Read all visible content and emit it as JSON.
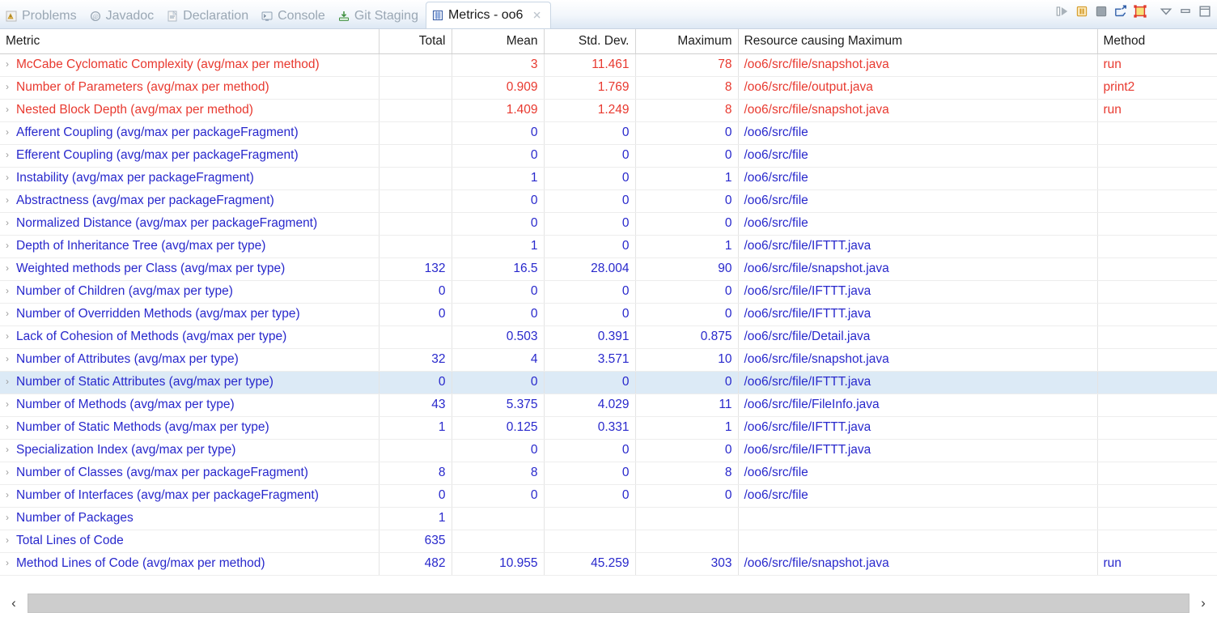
{
  "tabs": [
    {
      "label": "Problems",
      "icon": "problems-icon",
      "active": false
    },
    {
      "label": "Javadoc",
      "icon": "javadoc-icon",
      "active": false
    },
    {
      "label": "Declaration",
      "icon": "declaration-icon",
      "active": false
    },
    {
      "label": "Console",
      "icon": "console-icon",
      "active": false
    },
    {
      "label": "Git Staging",
      "icon": "git-staging-icon",
      "active": false
    },
    {
      "label": "Metrics - oo6",
      "icon": "metrics-icon",
      "active": true
    }
  ],
  "toolbar": {
    "buttons": [
      {
        "name": "run-metrics-icon",
        "title": "Run"
      },
      {
        "name": "pause-metrics-icon",
        "title": "Pause"
      },
      {
        "name": "stop-metrics-icon",
        "title": "Stop"
      },
      {
        "name": "export-metrics-icon",
        "title": "Export"
      },
      {
        "name": "dependency-graph-icon",
        "title": "Dependency Graph"
      },
      {
        "name": "view-menu-icon",
        "title": "View Menu"
      },
      {
        "name": "minimize-view-icon",
        "title": "Minimize"
      },
      {
        "name": "maximize-view-icon",
        "title": "Maximize"
      }
    ]
  },
  "table": {
    "columns": [
      {
        "label": "Metric",
        "align": "left"
      },
      {
        "label": "Total",
        "align": "right"
      },
      {
        "label": "Mean",
        "align": "right"
      },
      {
        "label": "Std. Dev.",
        "align": "right"
      },
      {
        "label": "Maximum",
        "align": "right"
      },
      {
        "label": "Resource causing Maximum",
        "align": "left"
      },
      {
        "label": "Method",
        "align": "left"
      }
    ],
    "rows": [
      {
        "metric": "McCabe Cyclomatic Complexity (avg/max per method)",
        "total": "",
        "mean": "3",
        "stddev": "11.461",
        "maximum": "78",
        "resource": "/oo6/src/file/snapshot.java",
        "method": "run",
        "color": "red",
        "selected": false
      },
      {
        "metric": "Number of Parameters (avg/max per method)",
        "total": "",
        "mean": "0.909",
        "stddev": "1.769",
        "maximum": "8",
        "resource": "/oo6/src/file/output.java",
        "method": "print2",
        "color": "red",
        "selected": false
      },
      {
        "metric": "Nested Block Depth (avg/max per method)",
        "total": "",
        "mean": "1.409",
        "stddev": "1.249",
        "maximum": "8",
        "resource": "/oo6/src/file/snapshot.java",
        "method": "run",
        "color": "red",
        "selected": false
      },
      {
        "metric": "Afferent Coupling (avg/max per packageFragment)",
        "total": "",
        "mean": "0",
        "stddev": "0",
        "maximum": "0",
        "resource": "/oo6/src/file",
        "method": "",
        "color": "blue",
        "selected": false
      },
      {
        "metric": "Efferent Coupling (avg/max per packageFragment)",
        "total": "",
        "mean": "0",
        "stddev": "0",
        "maximum": "0",
        "resource": "/oo6/src/file",
        "method": "",
        "color": "blue",
        "selected": false
      },
      {
        "metric": "Instability (avg/max per packageFragment)",
        "total": "",
        "mean": "1",
        "stddev": "0",
        "maximum": "1",
        "resource": "/oo6/src/file",
        "method": "",
        "color": "blue",
        "selected": false
      },
      {
        "metric": "Abstractness (avg/max per packageFragment)",
        "total": "",
        "mean": "0",
        "stddev": "0",
        "maximum": "0",
        "resource": "/oo6/src/file",
        "method": "",
        "color": "blue",
        "selected": false
      },
      {
        "metric": "Normalized Distance (avg/max per packageFragment)",
        "total": "",
        "mean": "0",
        "stddev": "0",
        "maximum": "0",
        "resource": "/oo6/src/file",
        "method": "",
        "color": "blue",
        "selected": false
      },
      {
        "metric": "Depth of Inheritance Tree (avg/max per type)",
        "total": "",
        "mean": "1",
        "stddev": "0",
        "maximum": "1",
        "resource": "/oo6/src/file/IFTTT.java",
        "method": "",
        "color": "blue",
        "selected": false
      },
      {
        "metric": "Weighted methods per Class (avg/max per type)",
        "total": "132",
        "mean": "16.5",
        "stddev": "28.004",
        "maximum": "90",
        "resource": "/oo6/src/file/snapshot.java",
        "method": "",
        "color": "blue",
        "selected": false
      },
      {
        "metric": "Number of Children (avg/max per type)",
        "total": "0",
        "mean": "0",
        "stddev": "0",
        "maximum": "0",
        "resource": "/oo6/src/file/IFTTT.java",
        "method": "",
        "color": "blue",
        "selected": false
      },
      {
        "metric": "Number of Overridden Methods (avg/max per type)",
        "total": "0",
        "mean": "0",
        "stddev": "0",
        "maximum": "0",
        "resource": "/oo6/src/file/IFTTT.java",
        "method": "",
        "color": "blue",
        "selected": false
      },
      {
        "metric": "Lack of Cohesion of Methods (avg/max per type)",
        "total": "",
        "mean": "0.503",
        "stddev": "0.391",
        "maximum": "0.875",
        "resource": "/oo6/src/file/Detail.java",
        "method": "",
        "color": "blue",
        "selected": false
      },
      {
        "metric": "Number of Attributes (avg/max per type)",
        "total": "32",
        "mean": "4",
        "stddev": "3.571",
        "maximum": "10",
        "resource": "/oo6/src/file/snapshot.java",
        "method": "",
        "color": "blue",
        "selected": false
      },
      {
        "metric": "Number of Static Attributes (avg/max per type)",
        "total": "0",
        "mean": "0",
        "stddev": "0",
        "maximum": "0",
        "resource": "/oo6/src/file/IFTTT.java",
        "method": "",
        "color": "blue",
        "selected": true
      },
      {
        "metric": "Number of Methods (avg/max per type)",
        "total": "43",
        "mean": "5.375",
        "stddev": "4.029",
        "maximum": "11",
        "resource": "/oo6/src/file/FileInfo.java",
        "method": "",
        "color": "blue",
        "selected": false
      },
      {
        "metric": "Number of Static Methods (avg/max per type)",
        "total": "1",
        "mean": "0.125",
        "stddev": "0.331",
        "maximum": "1",
        "resource": "/oo6/src/file/IFTTT.java",
        "method": "",
        "color": "blue",
        "selected": false
      },
      {
        "metric": "Specialization Index (avg/max per type)",
        "total": "",
        "mean": "0",
        "stddev": "0",
        "maximum": "0",
        "resource": "/oo6/src/file/IFTTT.java",
        "method": "",
        "color": "blue",
        "selected": false
      },
      {
        "metric": "Number of Classes (avg/max per packageFragment)",
        "total": "8",
        "mean": "8",
        "stddev": "0",
        "maximum": "8",
        "resource": "/oo6/src/file",
        "method": "",
        "color": "blue",
        "selected": false
      },
      {
        "metric": "Number of Interfaces (avg/max per packageFragment)",
        "total": "0",
        "mean": "0",
        "stddev": "0",
        "maximum": "0",
        "resource": "/oo6/src/file",
        "method": "",
        "color": "blue",
        "selected": false
      },
      {
        "metric": "Number of Packages",
        "total": "1",
        "mean": "",
        "stddev": "",
        "maximum": "",
        "resource": "",
        "method": "",
        "color": "blue",
        "selected": false
      },
      {
        "metric": "Total Lines of Code",
        "total": "635",
        "mean": "",
        "stddev": "",
        "maximum": "",
        "resource": "",
        "method": "",
        "color": "blue",
        "selected": false
      },
      {
        "metric": "Method Lines of Code (avg/max per method)",
        "total": "482",
        "mean": "10.955",
        "stddev": "45.259",
        "maximum": "303",
        "resource": "/oo6/src/file/snapshot.java",
        "method": "run",
        "color": "blue",
        "selected": false
      }
    ]
  },
  "scrollbar": {
    "left_arrow": "‹",
    "right_arrow": "›"
  },
  "colors": {
    "red": "#e8392f",
    "blue": "#2828cc",
    "selection": "#dceaf6"
  }
}
